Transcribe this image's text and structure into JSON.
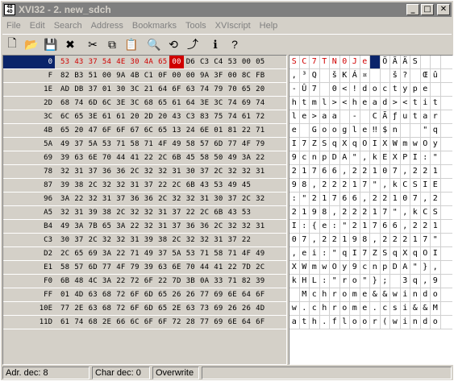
{
  "title": "XVI32 - 2. new_sdch",
  "app_icon_text": "XVI32",
  "window_buttons": {
    "minimize": "_",
    "maximize": "□",
    "close": "✕"
  },
  "menu": [
    "File",
    "Edit",
    "Search",
    "Address",
    "Bookmarks",
    "Tools",
    "XVIscript",
    "Help"
  ],
  "toolbar": [
    {
      "name": "new-file-icon",
      "glyph": "🗋"
    },
    {
      "name": "open-folder-icon",
      "glyph": "📂"
    },
    {
      "name": "save-icon",
      "glyph": "💾"
    },
    {
      "name": "close-file-icon",
      "glyph": "✖"
    },
    {
      "name": "cut-icon",
      "glyph": "✂"
    },
    {
      "name": "copy-icon",
      "glyph": "⧉"
    },
    {
      "name": "paste-icon",
      "glyph": "📋"
    },
    {
      "name": "find-icon",
      "glyph": "🔍"
    },
    {
      "name": "replace-icon",
      "glyph": "⟲"
    },
    {
      "name": "goto-icon",
      "glyph": "⤴"
    },
    {
      "name": "info-icon",
      "glyph": "ℹ"
    },
    {
      "name": "context-help-icon",
      "glyph": "?"
    }
  ],
  "addresses": [
    "0",
    "F",
    "1E",
    "2D",
    "3C",
    "4B",
    "5A",
    "69",
    "78",
    "87",
    "96",
    "A5",
    "B4",
    "C3",
    "D2",
    "E1",
    "F0",
    "FF",
    "10E",
    "11D"
  ],
  "hex_rows": [
    "53 43 37 54 4E 30 4A 65 00 D6 C3 C4 53 00 05",
    "82 B3 51 00 9A 4B C1 0F 00 00 9A 3F 00 8C FB",
    "AD DB 37 01 30 3C 21 64 6F 63 74 79 70 65 20",
    "68 74 6D 6C 3E 3C 68 65 61 64 3E 3C 74 69 74",
    "6C 65 3E 61 61 20 2D 20 43 C3 83 75 74 61 72",
    "65 20 47 6F 6F 67 6C 65 13 24 6E 01 81 22 71",
    "49 37 5A 53 71 58 71 4F 49 58 57 6D 77 4F 79",
    "39 63 6E 70 44 41 22 2C 6B 45 58 50 49 3A 22",
    "32 31 37 36 36 2C 32 32 31 30 37 2C 32 32 31",
    "39 38 2C 32 32 31 37 22 2C 6B 43 53 49 45",
    "3A 22 32 31 37 36 36 2C 32 32 31 30 37 2C 32",
    "32 31 39 38 2C 32 32 31 37 22 2C 6B 43 53",
    "49 3A 7B 65 3A 22 32 31 37 36 36 2C 32 32 31",
    "30 37 2C 32 32 31 39 38 2C 32 32 31 37 22",
    "2C 65 69 3A 22 71 49 37 5A 53 71 58 71 4F 49",
    "58 57 6D 77 4F 79 39 63 6E 70 44 41 22 7D 2C",
    "6B 48 4C 3A 22 72 6F 22 7D 3B 0A 33 71 82 39",
    "01 4D 63 68 72 6F 6D 65 26 26 77 69 6E 64 6F",
    "77 2E 63 68 72 6F 6D 65 2E 63 73 69 26 26 4D",
    "61 74 68 2E 66 6C 6F 6F 72 28 77 69 6E 64 6F"
  ],
  "text_rows": [
    [
      "S",
      "C",
      "7",
      "T",
      "N",
      "0",
      "J",
      "e",
      "",
      "Ö",
      "Ã",
      "Ä",
      "S",
      "",
      ""
    ],
    [
      ",",
      "³",
      "Q",
      "",
      "š",
      "K",
      "Á",
      "¤",
      "",
      "",
      "š",
      "?",
      "",
      "Œ",
      "û"
    ],
    [
      "-",
      "Û",
      "7",
      "",
      "0",
      "<",
      "!",
      "d",
      "o",
      "c",
      "t",
      "y",
      "p",
      "e",
      ""
    ],
    [
      "h",
      "t",
      "m",
      "l",
      ">",
      "<",
      "h",
      "e",
      "a",
      "d",
      ">",
      "<",
      "t",
      "i",
      "t"
    ],
    [
      "l",
      "e",
      ">",
      "a",
      "a",
      "",
      "-",
      "",
      "C",
      "Ã",
      "ƒ",
      "u",
      "t",
      "a",
      "r"
    ],
    [
      "e",
      "",
      "G",
      "o",
      "o",
      "g",
      "l",
      "e",
      "‼",
      "$",
      "n",
      "",
      "",
      "\"",
      "q"
    ],
    [
      "I",
      "7",
      "Z",
      "S",
      "q",
      "X",
      "q",
      "O",
      "I",
      "X",
      "W",
      "m",
      "w",
      "O",
      "y"
    ],
    [
      "9",
      "c",
      "n",
      "p",
      "D",
      "A",
      "\"",
      ",",
      "k",
      "E",
      "X",
      "P",
      "I",
      ":",
      "\""
    ],
    [
      "2",
      "1",
      "7",
      "6",
      "6",
      ",",
      "2",
      "2",
      "1",
      "0",
      "7",
      ",",
      "2",
      "2",
      "1"
    ],
    [
      "9",
      "8",
      ",",
      "2",
      "2",
      "2",
      "1",
      "7",
      "\"",
      ",",
      "k",
      "C",
      "S",
      "I",
      "E"
    ],
    [
      ":",
      "\"",
      "2",
      "1",
      "7",
      "6",
      "6",
      ",",
      "2",
      "2",
      "1",
      "0",
      "7",
      ",",
      "2"
    ],
    [
      "2",
      "1",
      "9",
      "8",
      ",",
      "2",
      "2",
      "2",
      "1",
      "7",
      "\"",
      ",",
      "k",
      "C",
      "S"
    ],
    [
      "I",
      ":",
      "{",
      "e",
      ":",
      "\"",
      "2",
      "1",
      "7",
      "6",
      "6",
      ",",
      "2",
      "2",
      "1"
    ],
    [
      "0",
      "7",
      ",",
      "2",
      "2",
      "1",
      "9",
      "8",
      ",",
      "2",
      "2",
      "2",
      "1",
      "7",
      "\""
    ],
    [
      ",",
      "e",
      "i",
      ":",
      "\"",
      "q",
      "I",
      "7",
      "Z",
      "S",
      "q",
      "X",
      "q",
      "O",
      "I"
    ],
    [
      "X",
      "W",
      "m",
      "w",
      "O",
      "y",
      "9",
      "c",
      "n",
      "p",
      "D",
      "A",
      "\"",
      "}",
      ","
    ],
    [
      "k",
      "H",
      "L",
      ":",
      "\"",
      "r",
      "o",
      "\"",
      "}",
      ";",
      "",
      "3",
      "q",
      ",",
      "9"
    ],
    [
      "",
      "M",
      "c",
      "h",
      "r",
      "o",
      "m",
      "e",
      "&",
      "&",
      "w",
      "i",
      "n",
      "d",
      "o"
    ],
    [
      "w",
      ".",
      "c",
      "h",
      "r",
      "o",
      "m",
      "e",
      ".",
      "c",
      "s",
      "i",
      "&",
      "&",
      "M"
    ],
    [
      "a",
      "t",
      "h",
      ".",
      "f",
      "l",
      "o",
      "o",
      "r",
      "(",
      "w",
      "i",
      "n",
      "d",
      "o"
    ]
  ],
  "status": {
    "adr": "Adr. dec: 8",
    "char": "Char dec: 0",
    "mode": "Overwrite"
  },
  "colors": {
    "highlight_red": "#d00000",
    "selection_blue": "#0a246a"
  }
}
